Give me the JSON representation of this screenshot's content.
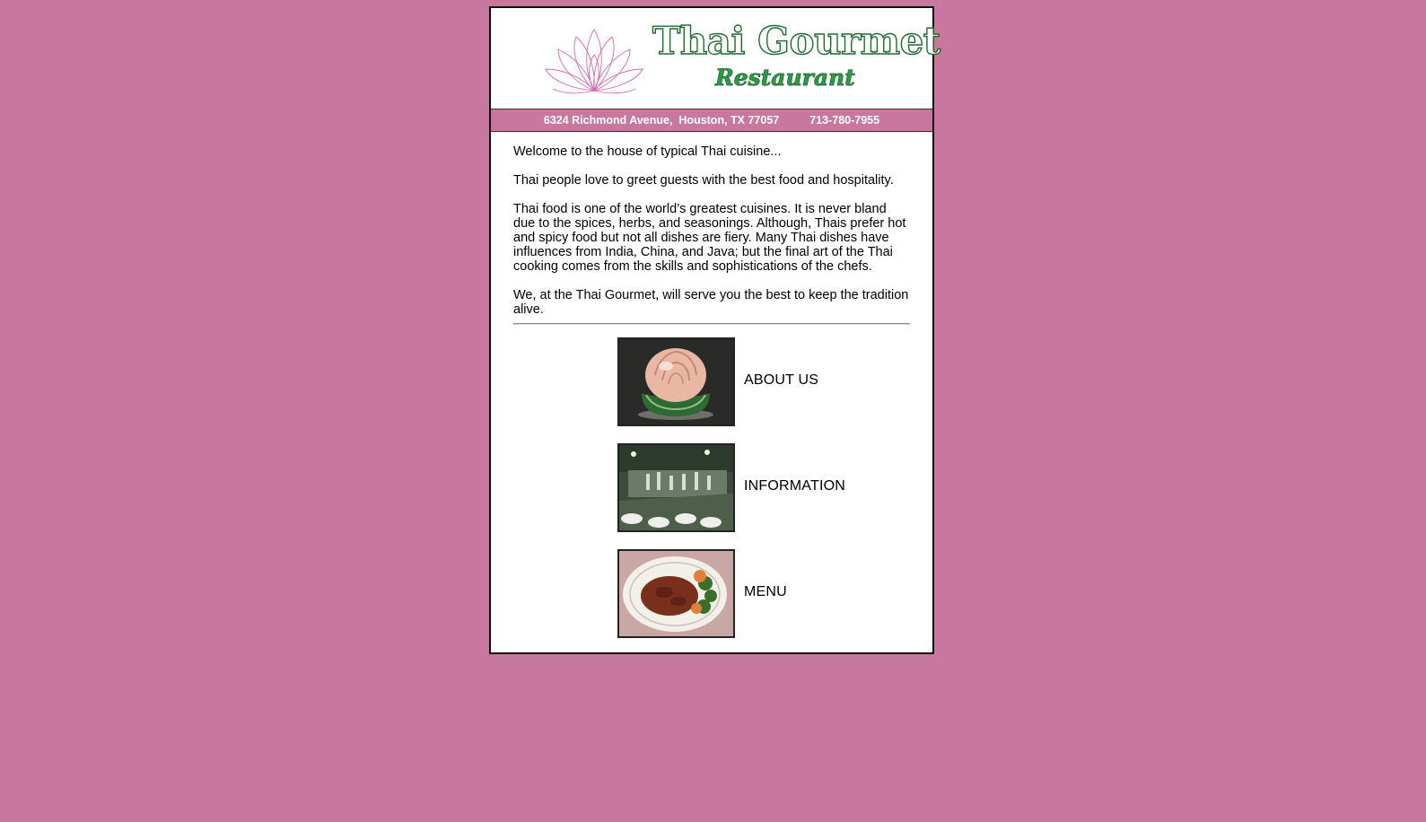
{
  "header": {
    "title": "Thai Gourmet",
    "subtitle": "Restaurant",
    "logo_icon": "lotus-flower-icon"
  },
  "address_bar": {
    "address": "6324 Richmond Avenue,  Houston, TX 77057",
    "phone": "713-780-7955"
  },
  "intro": {
    "paragraphs": [
      "Welcome to the house of typical Thai cuisine...",
      "Thai people love to greet guests with the best food and hospitality.",
      "Thai food is one of the world’s greatest cuisines. It is never bland due to the spices, herbs, and seasonings. Although, Thais prefer hot and spicy food but not all dishes are fiery. Many Thai dishes have influences from India, China, and Java; but the final art of the Thai cooking comes from the skills and sophistications of the chefs.",
      "We, at the Thai Gourmet, will serve you the best to keep the tradition alive."
    ]
  },
  "nav": {
    "items": [
      {
        "label": "ABOUT US",
        "image": "carved-rose-photo"
      },
      {
        "label": "INFORMATION",
        "image": "dining-room-photo"
      },
      {
        "label": "MENU",
        "image": "dish-plate-photo"
      }
    ]
  },
  "colors": {
    "background": "#c8789e",
    "title_green": "#1f6b2e",
    "lotus_pink": "#d36aa8"
  }
}
